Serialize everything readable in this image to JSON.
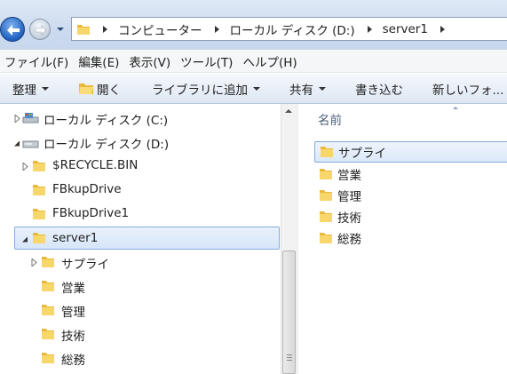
{
  "address": {
    "crumbs": [
      "コンピューター",
      "ローカル ディスク (D:)",
      "server1"
    ]
  },
  "menubar": [
    "ファイル(F)",
    "編集(E)",
    "表示(V)",
    "ツール(T)",
    "ヘルプ(H)"
  ],
  "commandbar": {
    "organize": "整理",
    "open": "開く",
    "add_to_library": "ライブラリに追加",
    "share": "共有",
    "burn": "書き込む",
    "new_folder": "新しいフォ..."
  },
  "nav_tree": {
    "drive_c": "ローカル ディスク (C:)",
    "drive_d": "ローカル ディスク (D:)",
    "recycle": "$RECYCLE.BIN",
    "fbkup": "FBkupDrive",
    "fbkup1": "FBkupDrive1",
    "server1": "server1",
    "supply": "サプライ",
    "eigyo": "営業",
    "kanri": "管理",
    "gijutsu": "技術",
    "soumu": "総務"
  },
  "content": {
    "column_name": "名前",
    "files": [
      "サプライ",
      "営業",
      "管理",
      "技術",
      "総務"
    ]
  },
  "colors": {
    "selection_border": "#84acdd",
    "folder_yellow": "#f2c94c"
  }
}
